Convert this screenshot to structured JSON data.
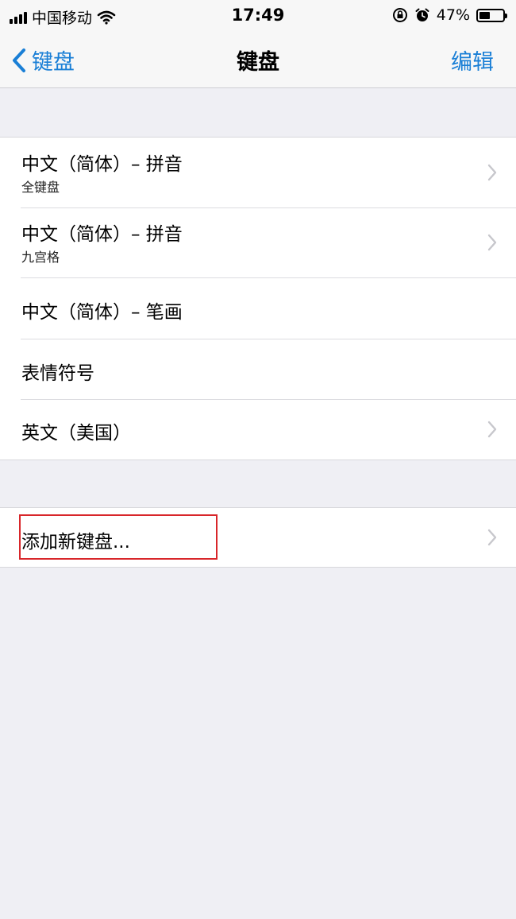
{
  "status": {
    "carrier": "中国移动",
    "time": "17:49",
    "battery": "47%",
    "battery_level": 0.47
  },
  "nav": {
    "back_label": "键盘",
    "title": "键盘",
    "edit_label": "编辑"
  },
  "keyboards": [
    {
      "title": "中文（简体）– 拼音",
      "subtitle": "全键盘"
    },
    {
      "title": "中文（简体）– 拼音",
      "subtitle": "九宫格"
    },
    {
      "title": "中文（简体）– 笔画"
    },
    {
      "title": "表情符号"
    },
    {
      "title": "英文（美国）"
    }
  ],
  "add_keyboard": {
    "label": "添加新键盘..."
  },
  "colors": {
    "accent": "#1a7fd6",
    "highlight": "#d8262a",
    "background": "#efeff4"
  }
}
